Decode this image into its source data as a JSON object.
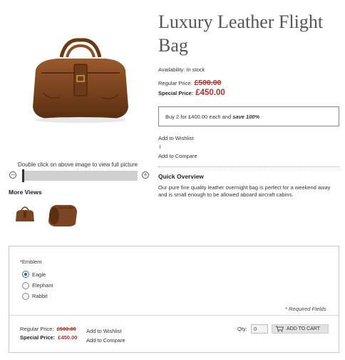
{
  "product": {
    "title": "Luxury Leather Flight Bag",
    "availability": "Availability: In stock",
    "regular_price_label": "Regular Price:",
    "regular_price": "£500.00",
    "special_price_label": "Special Price:",
    "special_price": "£450.00",
    "tier_text": "Buy 2 for £400.00 each and ",
    "tier_save": "save 100%",
    "add_to_wishlist": "Add to Wishlist",
    "add_to_compare": "Add to Compare",
    "quick_overview_title": "Quick Overview",
    "quick_overview_text": "Our pure fine quality leather overnight bag is perfect for a weekend away and is small enough to be allowed aboard aircraft cabins."
  },
  "gallery": {
    "hint": "Double click on above image to view full picture",
    "zoom_out_icon": "minus-circle-icon",
    "zoom_in_icon": "plus-circle-icon",
    "zoom_level": 0,
    "more_views_title": "More Views"
  },
  "options": {
    "emblem_label": "*Emblem",
    "choices": [
      "Eagle",
      "Elephant",
      "Rabbit"
    ],
    "selected": "Eagle",
    "required_note": "* Required Fields"
  },
  "add_to_cart_box": {
    "regular_price_label": "Regular Price:",
    "regular_price": "£500.00",
    "special_price_label": "Special Price:",
    "special_price": "£450.00",
    "add_to_wishlist": "Add to Wishlist",
    "add_to_compare": "Add to Compare",
    "qty_label": "Qty:",
    "qty_value": "0",
    "cart_button": "ADD TO CART",
    "cart_icon": "cart-icon"
  },
  "colors": {
    "price_red": "#b03030",
    "leather_brown": "#7a4520",
    "radio_blue": "#2a5db0"
  }
}
